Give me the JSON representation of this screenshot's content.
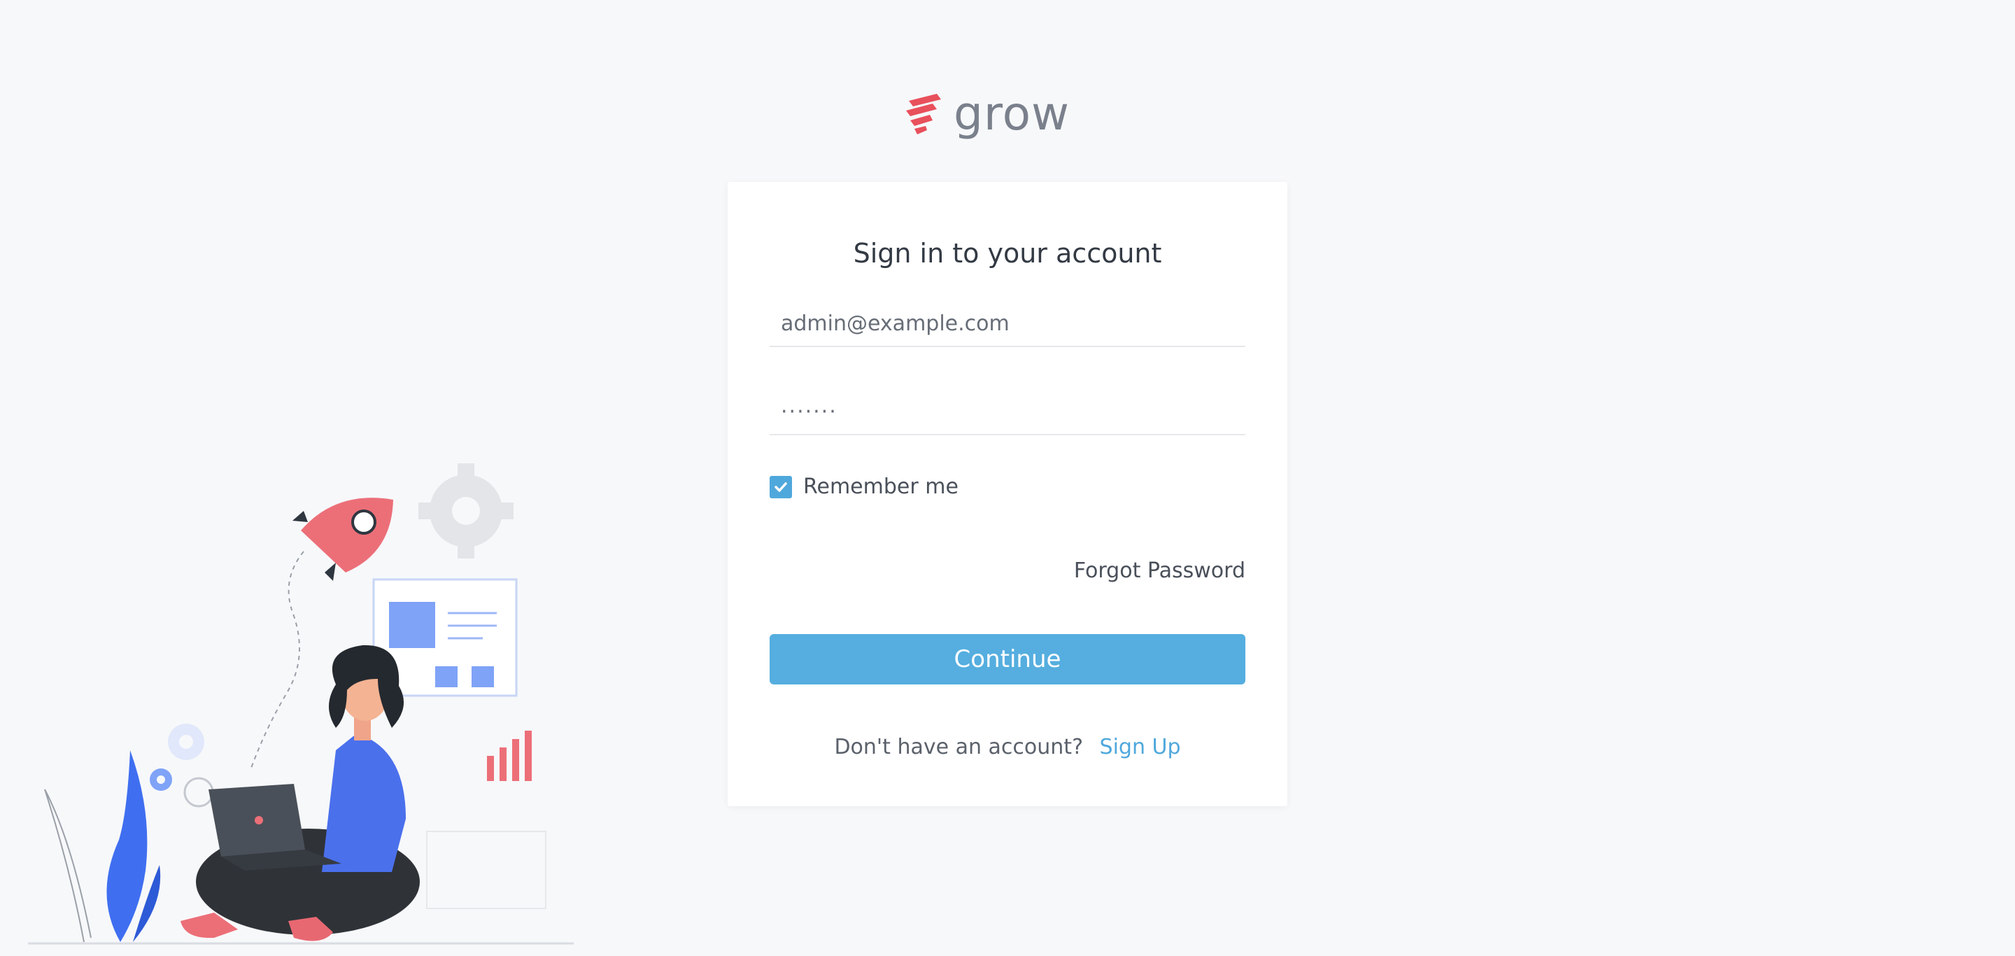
{
  "brand": {
    "name": "grow",
    "logo_icon": "stacked-chevrons-logo",
    "logo_color": "#e8505b"
  },
  "login": {
    "title": "Sign in to your account",
    "email_value": "admin@example.com",
    "password_value": "·······",
    "remember_label": "Remember me",
    "remember_checked": true,
    "forgot_label": "Forgot Password",
    "continue_label": "Continue",
    "signup_prompt": "Don't have an account?",
    "signup_label": "Sign Up"
  },
  "colors": {
    "accent": "#55aedf",
    "link": "#4fa8dc",
    "background": "#f7f8fa"
  },
  "illustration": {
    "name": "woman-with-laptop-rocket-illustration"
  }
}
